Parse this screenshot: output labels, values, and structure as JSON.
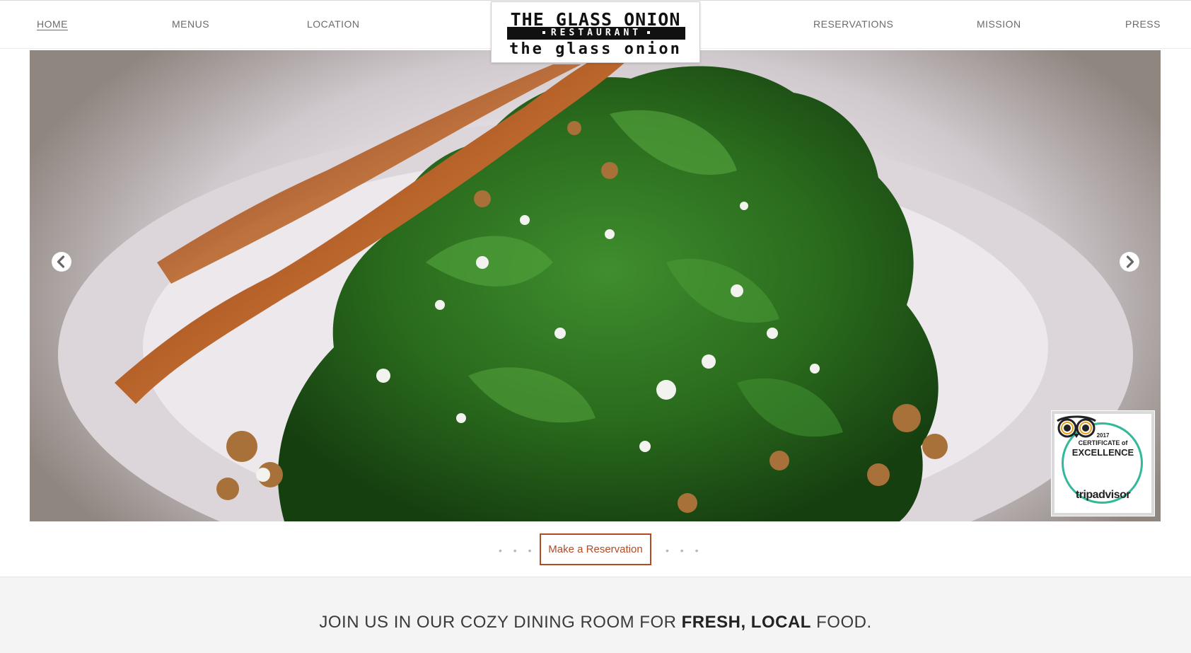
{
  "nav": {
    "left": [
      {
        "label": "HOME",
        "active": true
      },
      {
        "label": "MENUS",
        "active": false
      },
      {
        "label": "LOCATION",
        "active": false
      }
    ],
    "right": [
      {
        "label": "RESERVATIONS",
        "active": false
      },
      {
        "label": "MISSION",
        "active": false
      },
      {
        "label": "PRESS",
        "active": false
      }
    ]
  },
  "logo": {
    "line1": "THE GLASS ONION",
    "line2": "RESTAURANT",
    "line3": "the glass onion"
  },
  "hero": {
    "prev_icon": "chevron-left-icon",
    "next_icon": "chevron-right-icon"
  },
  "badge": {
    "year": "2017",
    "title": "CERTIFICATE of",
    "subtitle": "EXCELLENCE",
    "brand": "tripadvisor",
    "icon": "tripadvisor-owl-icon",
    "color": "#34b89a"
  },
  "cta": {
    "label": "Make a Reservation",
    "dots": "• • •",
    "color": "#b24a26"
  },
  "tagline": {
    "before": "JOIN US IN OUR COZY DINING ROOM FOR ",
    "emphasis": "FRESH, LOCAL",
    "after": " FOOD."
  }
}
